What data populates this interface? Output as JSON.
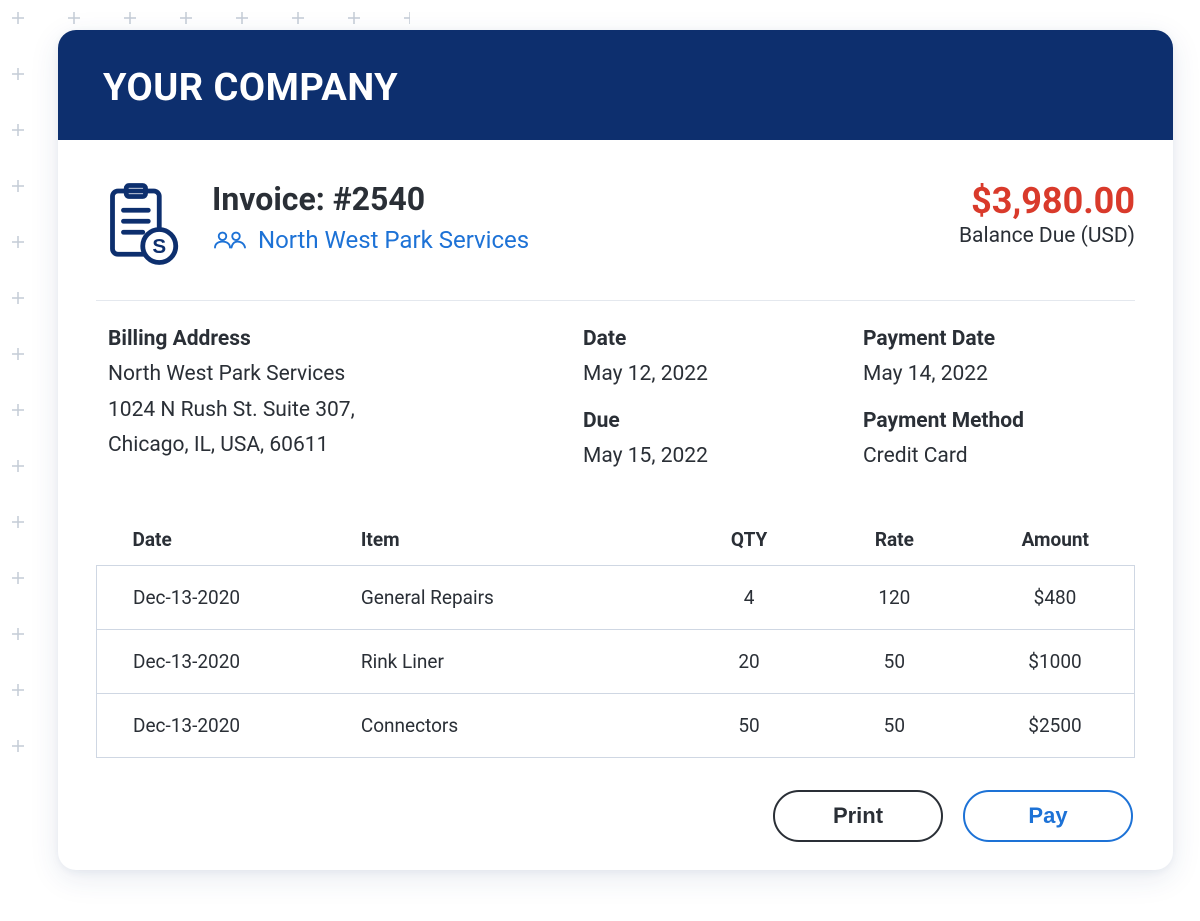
{
  "company_name": "YOUR COMPANY",
  "invoice": {
    "title": "Invoice: #2540",
    "customer_name": "North West Park Services",
    "balance_amount": "$3,980.00",
    "balance_label": "Balance Due (USD)"
  },
  "meta": {
    "billing_heading": "Billing Address",
    "billing_line1": "North West Park Services",
    "billing_line2": "1024 N Rush St. Suite 307,",
    "billing_line3": "Chicago, IL, USA, 60611",
    "date_heading": "Date",
    "date_value": "May 12, 2022",
    "due_heading": "Due",
    "due_value": "May 15, 2022",
    "payment_date_heading": "Payment Date",
    "payment_date_value": "May 14, 2022",
    "payment_method_heading": "Payment Method",
    "payment_method_value": "Credit Card"
  },
  "table": {
    "headers": {
      "date": "Date",
      "item": "Item",
      "qty": "QTY",
      "rate": "Rate",
      "amount": "Amount"
    },
    "rows": [
      {
        "date": "Dec-13-2020",
        "item": "General Repairs",
        "qty": "4",
        "rate": "120",
        "amount": "$480"
      },
      {
        "date": "Dec-13-2020",
        "item": "Rink Liner",
        "qty": "20",
        "rate": "50",
        "amount": "$1000"
      },
      {
        "date": "Dec-13-2020",
        "item": "Connectors",
        "qty": "50",
        "rate": "50",
        "amount": "$2500"
      }
    ]
  },
  "actions": {
    "print_label": "Print",
    "pay_label": "Pay"
  }
}
